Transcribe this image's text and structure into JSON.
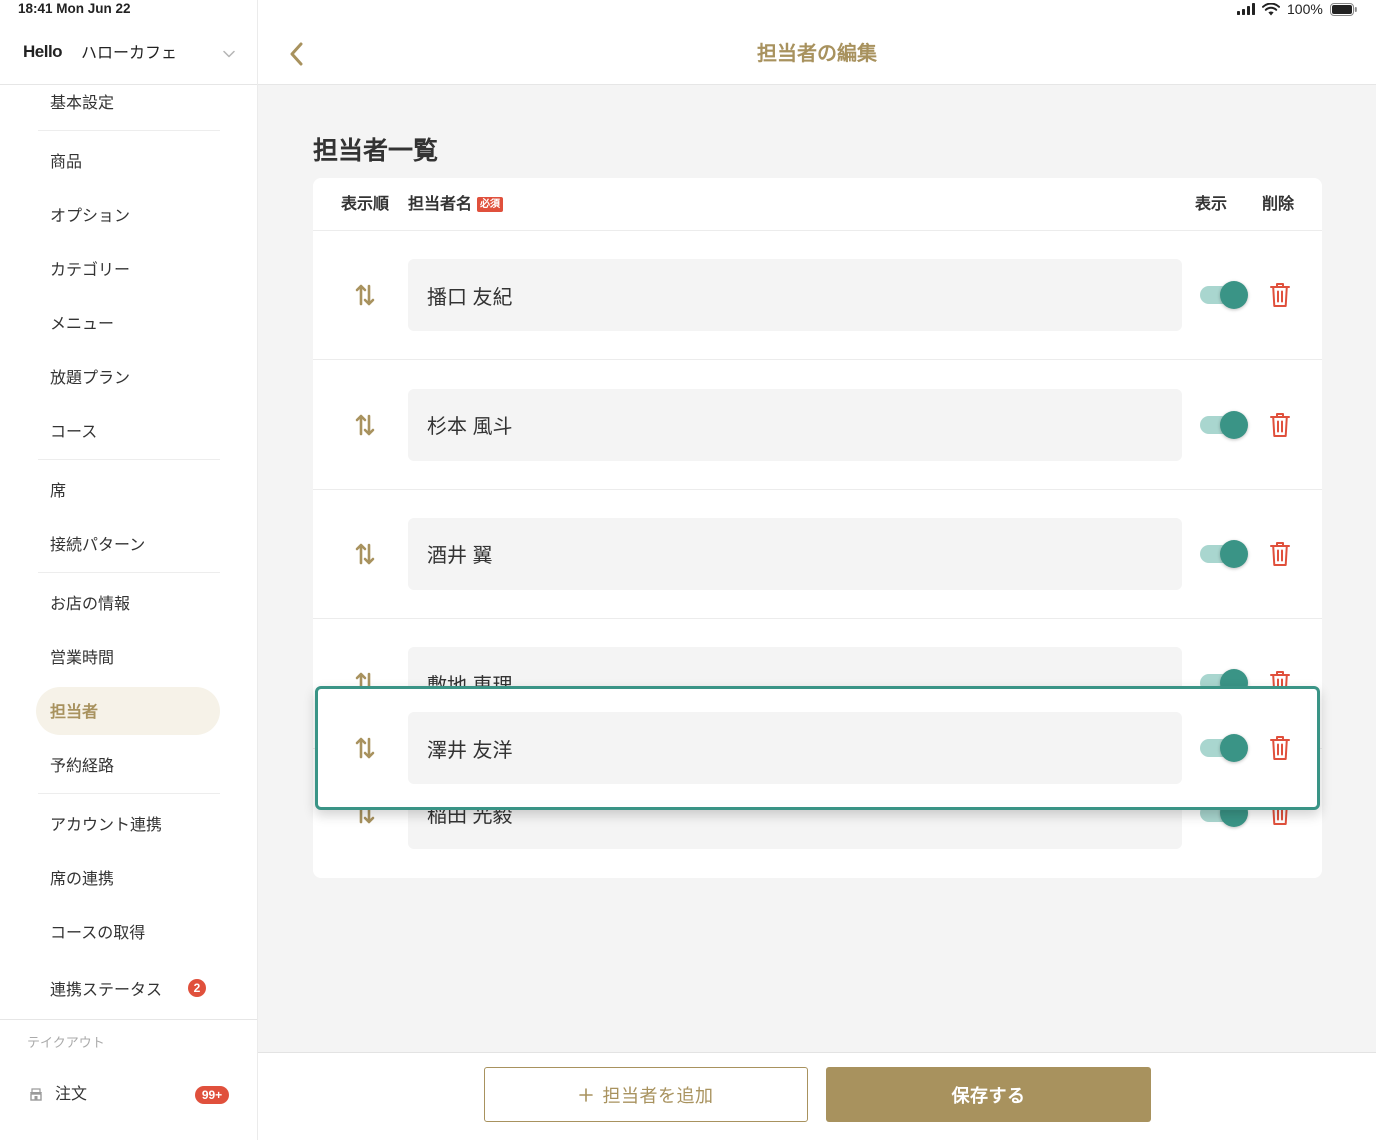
{
  "status_bar": {
    "time": "18:41 Mon Jun 22",
    "battery": "100%",
    "icons": [
      "cellular-signal-icon",
      "wifi-icon",
      "battery-icon"
    ]
  },
  "colors": {
    "accent": "#a8925e",
    "teal": "#3a9486",
    "teal_light": "#a9d6cf",
    "danger": "#e0503c",
    "active_bg": "#f6f2e8"
  },
  "sidebar": {
    "logo": "Hello",
    "store_name": "ハローカフェ",
    "items": [
      {
        "label": "基本設定"
      },
      {
        "label": "商品"
      },
      {
        "label": "オプション"
      },
      {
        "label": "カテゴリー"
      },
      {
        "label": "メニュー"
      },
      {
        "label": "放題プラン"
      },
      {
        "label": "コース"
      },
      {
        "label": "席"
      },
      {
        "label": "接続パターン"
      },
      {
        "label": "お店の情報"
      },
      {
        "label": "営業時間"
      },
      {
        "label": "担当者",
        "active": true
      },
      {
        "label": "予約経路"
      },
      {
        "label": "アカウント連携"
      },
      {
        "label": "席の連携"
      },
      {
        "label": "コースの取得"
      },
      {
        "label": "連携ステータス",
        "badge": "2"
      }
    ],
    "takeout": {
      "section_label": "テイクアウト",
      "items": [
        {
          "label": "注文",
          "badge": "99+",
          "icon": "shop-icon"
        }
      ]
    }
  },
  "main": {
    "header": {
      "title": "担当者の編集",
      "back_icon": "chevron-left-icon"
    },
    "section_title": "担当者一覧",
    "table": {
      "columns": {
        "order": "表示順",
        "name": "担当者名",
        "required_badge": "必須",
        "visible": "表示",
        "delete": "削除"
      },
      "rows": [
        {
          "name": "播口 友紀",
          "visible": true
        },
        {
          "name": "杉本 風斗",
          "visible": true
        },
        {
          "name": "酒井 翼",
          "visible": true
        },
        {
          "name": "敷地 恵理",
          "visible": true
        },
        {
          "name": "稲田 光毅",
          "visible": true
        }
      ],
      "dragging_row": {
        "name": "澤井 友洋",
        "visible": true
      }
    },
    "footer": {
      "add_icon": "plus-icon",
      "add_button": "担当者を追加",
      "save_button": "保存する"
    }
  }
}
